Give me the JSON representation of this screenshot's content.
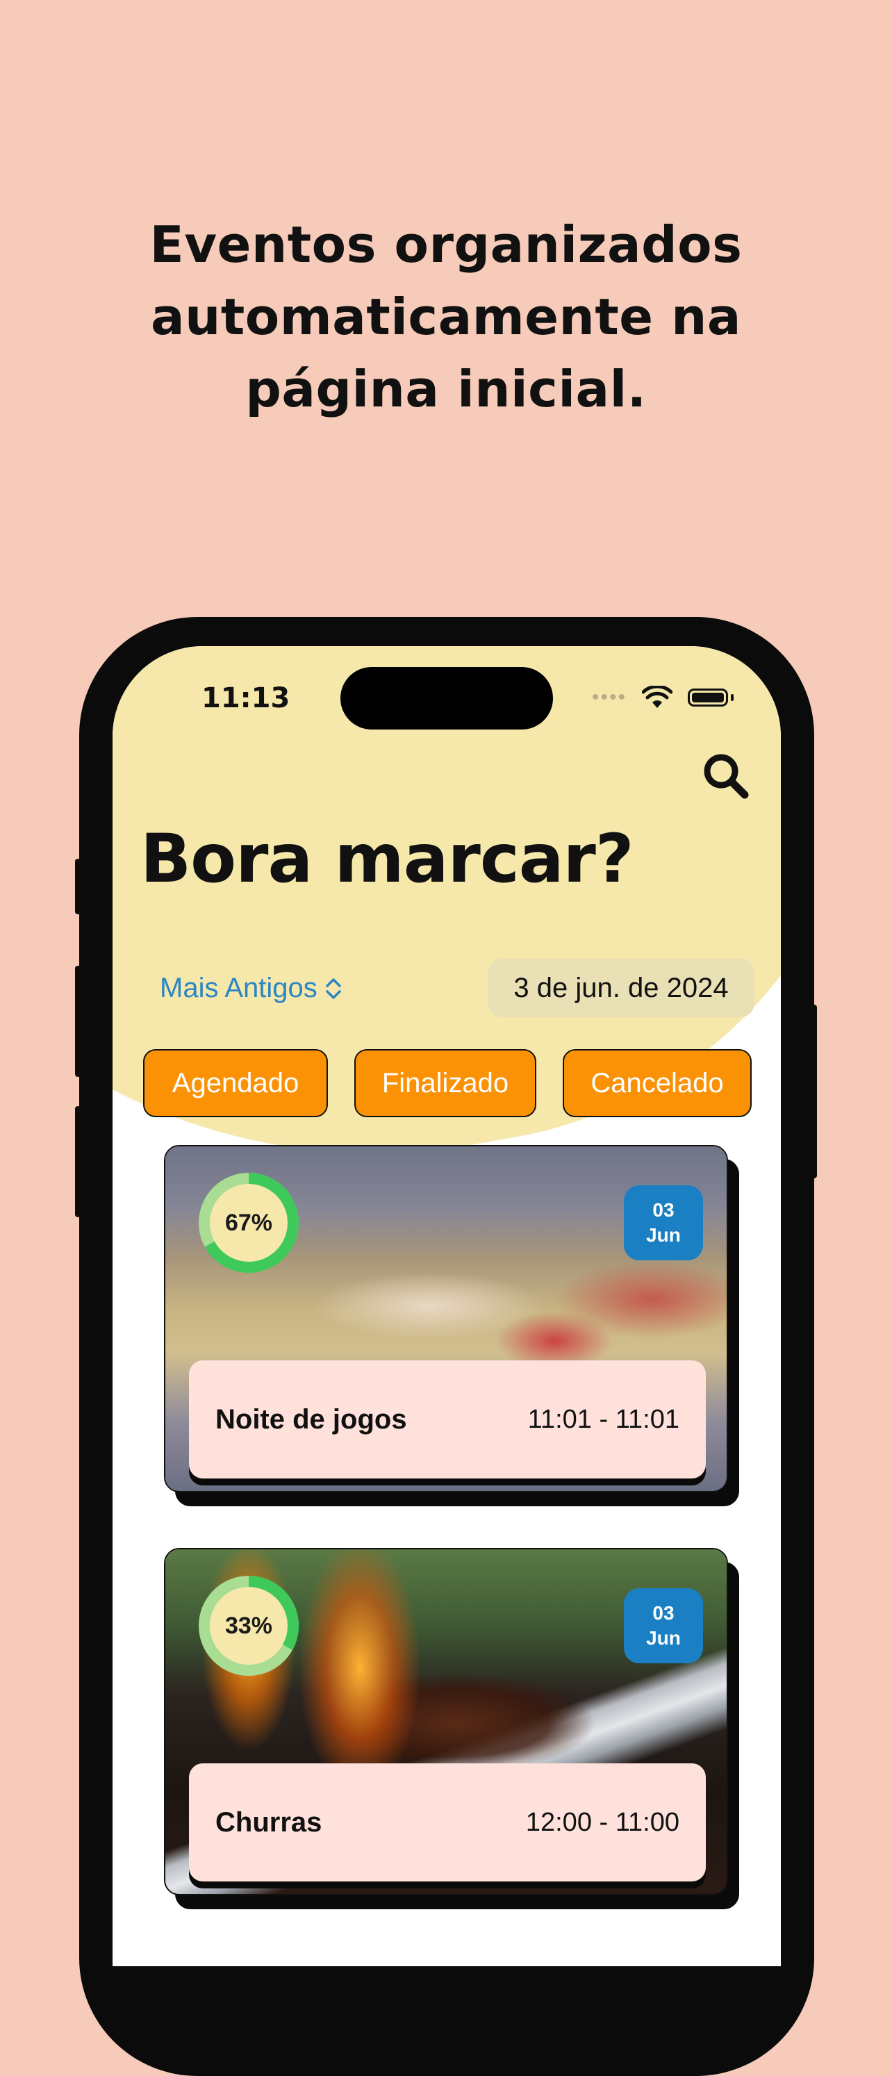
{
  "headline": {
    "line1": "Eventos organizados",
    "line2": "automaticamente na",
    "line3": "página inicial."
  },
  "status_bar": {
    "time": "11:13"
  },
  "app": {
    "title": "Bora marcar?",
    "sort_label": "Mais Antigos",
    "date_filter": "3 de jun. de 2024",
    "filters": [
      "Agendado",
      "Finalizado",
      "Cancelado"
    ]
  },
  "events": [
    {
      "name": "Noite de jogos",
      "time": "11:01 - 11:01",
      "progress_label": "67%",
      "progress": 0.67,
      "day": "03",
      "month": "Jun"
    },
    {
      "name": "Churras",
      "time": "12:00 - 11:00",
      "progress_label": "33%",
      "progress": 0.33,
      "day": "03",
      "month": "Jun"
    }
  ],
  "colors": {
    "background": "#f7cbb9",
    "app_header": "#f6e8ab",
    "filter_button": "#fb9205",
    "accent_blue": "#1b7fc3",
    "ring_green": "#3ec95a"
  }
}
